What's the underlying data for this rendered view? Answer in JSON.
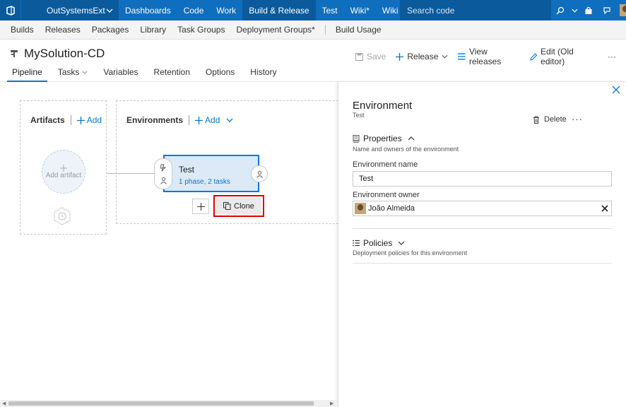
{
  "topbar": {
    "project": "OutSystemsExt",
    "nav": [
      "Dashboards",
      "Code",
      "Work",
      "Build & Release",
      "Test",
      "Wiki*",
      "Wiki"
    ],
    "active_index": 3,
    "search_placeholder": "Search code"
  },
  "subnav": {
    "items": [
      "Builds",
      "Releases",
      "Packages",
      "Library",
      "Task Groups",
      "Deployment Groups*"
    ],
    "extra": "Build Usage"
  },
  "titlebar": {
    "title": "MySolution-CD",
    "save": "Save",
    "release": "Release",
    "view_releases": "View releases",
    "edit": "Edit (Old editor)",
    "more": "···"
  },
  "tabs": [
    "Pipeline",
    "Tasks",
    "Variables",
    "Retention",
    "Options",
    "History"
  ],
  "canvas": {
    "artifacts_label": "Artifacts",
    "artifacts_add": "Add",
    "add_artifact": "Add artifact",
    "environments_label": "Environments",
    "environments_add": "Add",
    "env_name": "Test",
    "env_tasks": "1 phase, 2 tasks",
    "clone": "Clone"
  },
  "panel": {
    "title": "Environment",
    "subtitle": "Test",
    "delete": "Delete",
    "more": "···",
    "properties_head": "Properties",
    "properties_desc": "Name and owners of the environment",
    "name_label": "Environment name",
    "name_value": "Test",
    "owner_label": "Environment owner",
    "owner_value": "João Almeida",
    "policies_head": "Policies",
    "policies_desc": "Deployment policies for this environment"
  },
  "colors": {
    "accent": "#0078d4",
    "topbar": "#106ebe",
    "highlight": "#e00000"
  }
}
